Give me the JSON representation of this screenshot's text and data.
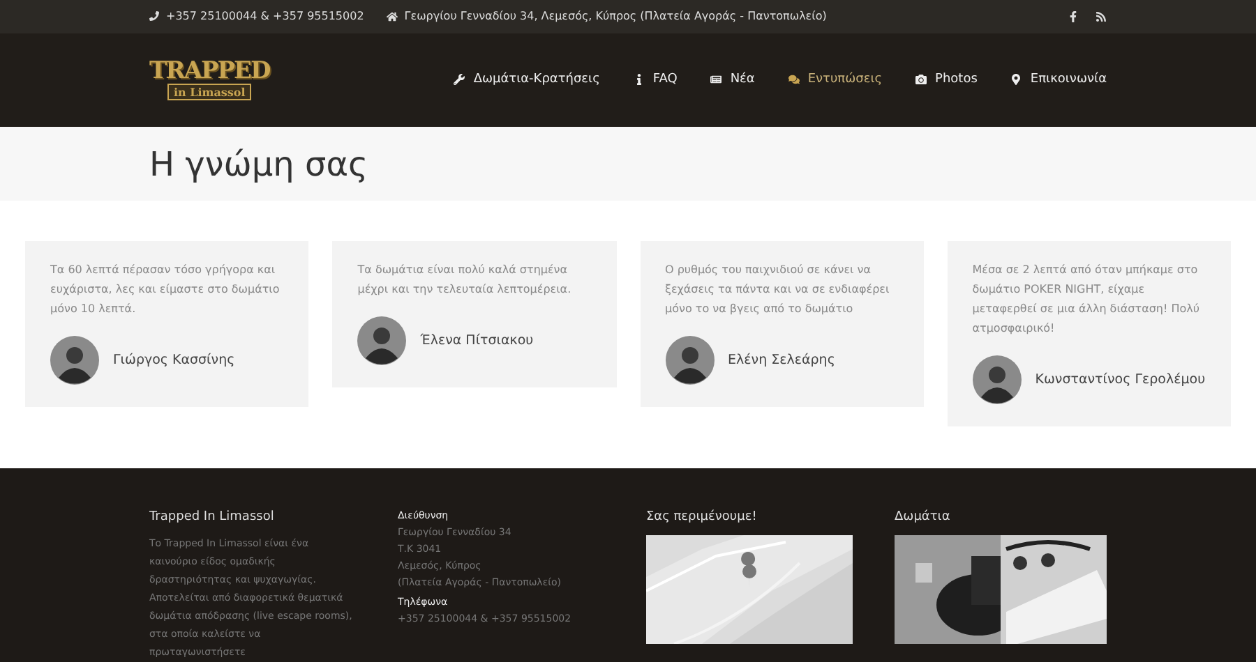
{
  "topbar": {
    "phone": "+357 25100044 & +357 95515002",
    "address": "Γεωργίου Γενναδίου 34, Λεμεσός, Κύπρος (Πλατεία Αγοράς - Παντοπωλείο)"
  },
  "logo": {
    "title": "TRAPPED",
    "subtitle": "in Limassol"
  },
  "nav": [
    {
      "label": "Δωμάτια-Κρατήσεις",
      "selected": false
    },
    {
      "label": "FAQ",
      "selected": false
    },
    {
      "label": "Νέα",
      "selected": false
    },
    {
      "label": "Εντυπώσεις",
      "selected": true
    },
    {
      "label": "Photos",
      "selected": false
    },
    {
      "label": "Επικοινωνία",
      "selected": false
    }
  ],
  "page_title": "Η γνώμη σας",
  "testimonials": [
    {
      "quote": "Τα 60 λεπτά πέρασαν τόσο γρήγορα και ευχάριστα, λες και είμαστε στο δωμάτιο μόνο 10 λεπτά.",
      "name": "Γιώργος Κασσίνης"
    },
    {
      "quote": "Τα δωμάτια είναι πολύ καλά στημένα μέχρι και την τελευταία λεπτομέρεια.",
      "name": "Έλενα Πίτσιακου"
    },
    {
      "quote": "Ο ρυθμός του παιχνιδιού σε κάνει να ξεχάσεις τα πάντα και να σε ενδιαφέρει μόνο το να βγεις από το δωμάτιο",
      "name": "Ελένη Σελεάρης"
    },
    {
      "quote": "Μέσα σε 2 λεπτά από όταν μπήκαμε στο δωμάτιο POKER NIGHT, είχαμε μεταφερθεί σε μια άλλη διάσταση! Πολύ ατμοσφαιρικό!",
      "name": "Κωνσταντίνος Γερολέμου"
    }
  ],
  "footer": {
    "about": {
      "heading": "Trapped In Limassol",
      "text": "Το Trapped In Limassol είναι ένα καινούριο είδος ομαδικής δραστηριότητας και ψυχαγωγίας. Αποτελείται από διαφορετικά θεματικά δωμάτια απόδρασης (live escape rooms), στα οποία καλείστε να πρωταγωνιστήσετε"
    },
    "contact": {
      "address_heading": "Διεύθυνση",
      "address_lines": [
        "Γεωργίου Γενναδίου 34",
        "Τ.Κ 3041",
        "Λεμεσός, Κύπρος",
        "(Πλατεία Αγοράς - Παντοπωλείο)"
      ],
      "phone_heading": "Τηλέφωνα",
      "phone": "+357 25100044 & +357 95515002"
    },
    "map": {
      "heading": "Σας περιμένουμε!",
      "kind": "picture"
    },
    "rooms": {
      "heading": "Δωμάτια",
      "kind": "picture"
    }
  }
}
